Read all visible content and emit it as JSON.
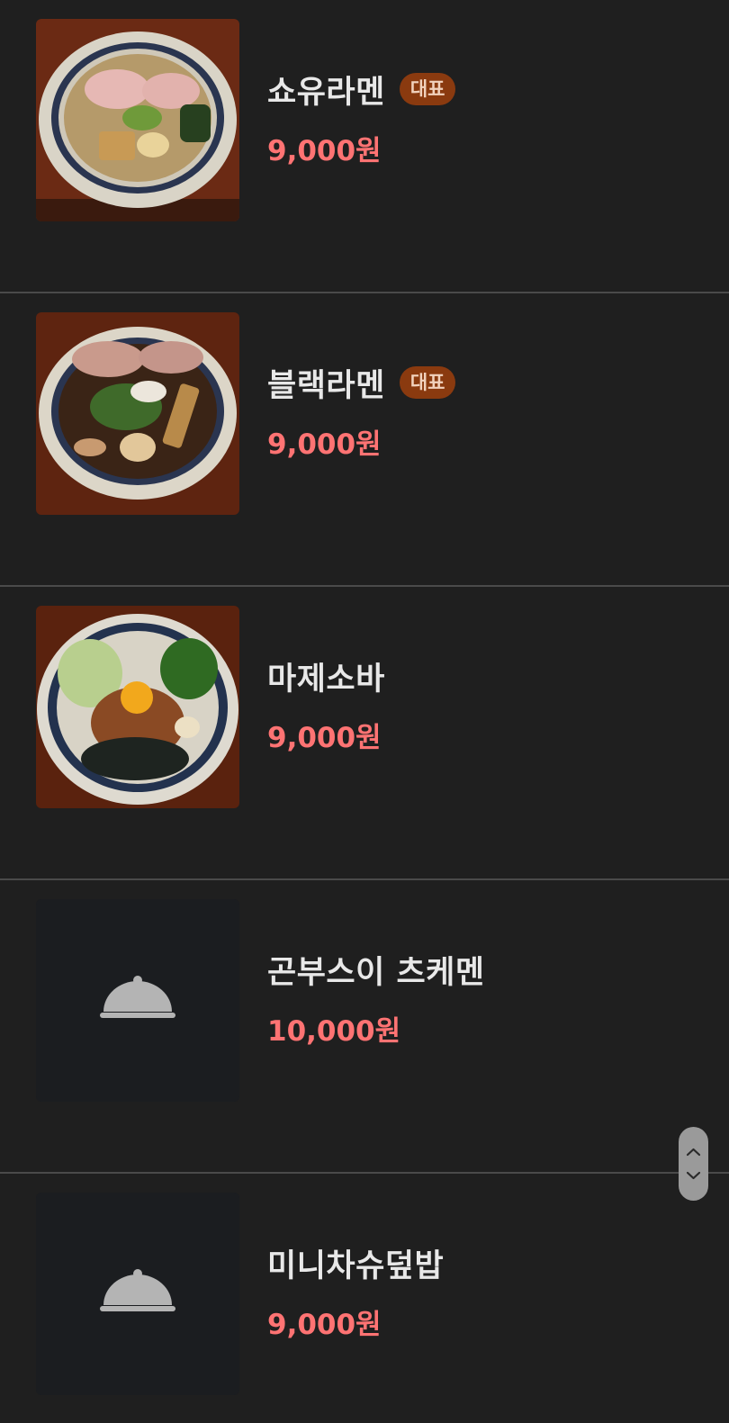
{
  "menu": {
    "items": [
      {
        "name": "쇼유라멘",
        "badge": "대표",
        "price": "9,000원",
        "image_icon": "shoyu-ramen-photo"
      },
      {
        "name": "블랙라멘",
        "badge": "대표",
        "price": "9,000원",
        "image_icon": "black-ramen-photo"
      },
      {
        "name": "마제소바",
        "badge": "",
        "price": "9,000원",
        "image_icon": "mazesoba-photo"
      },
      {
        "name": "곤부스이 츠케멘",
        "badge": "",
        "price": "10,000원",
        "image_icon": "cloche-icon"
      },
      {
        "name": "미니차슈덮밥",
        "badge": "",
        "price": "9,000원",
        "image_icon": "cloche-icon"
      }
    ]
  },
  "scroll_control": {
    "up_icon": "chevron-up-icon",
    "down_icon": "chevron-down-icon"
  },
  "colors": {
    "background": "#1f1f1f",
    "price": "#ff7373",
    "badge_bg": "#8a3a0f",
    "badge_text": "#f1d2bd",
    "placeholder_bg": "#1b1d20"
  }
}
